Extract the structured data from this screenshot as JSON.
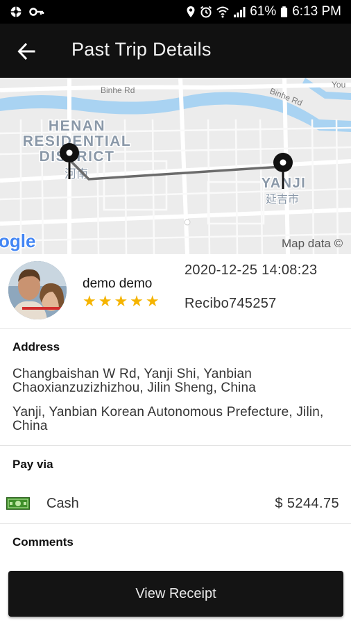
{
  "status_bar": {
    "battery": "61%",
    "time": "6:13 PM"
  },
  "header": {
    "title": "Past Trip Details"
  },
  "map": {
    "labels": {
      "road_top_left": "Binhe Rd",
      "road_top_right": "Binhe Rd",
      "road_top_far_right": "You",
      "district_line1": "HENAN",
      "district_line2": "RESIDENTIAL",
      "district_line3": "DISTRICT",
      "district_cn": "河南",
      "city": "YANJI",
      "city_cn": "延吉市",
      "google_logo": "ogle",
      "attribution": "Map data ©"
    }
  },
  "trip": {
    "driver_name": "demo demo",
    "rating": 5,
    "stars": "★★★★★",
    "datetime": "2020-12-25 14:08:23",
    "receipt_id": "Recibo745257"
  },
  "address": {
    "title": "Address",
    "pickup": "Changbaishan W Rd, Yanji Shi, Yanbian Chaoxianzuzizhizhou, Jilin Sheng, China",
    "dropoff": "Yanji, Yanbian Korean Autonomous Prefecture, Jilin, China"
  },
  "payment": {
    "title": "Pay via",
    "method": "Cash",
    "amount": "$ 5244.75"
  },
  "comments": {
    "title": "Comments"
  },
  "actions": {
    "view_receipt": "View Receipt"
  },
  "colors": {
    "app_bar": "#111111",
    "star": "#f5b400",
    "map_water": "#a9d3f2",
    "button": "#141414"
  }
}
